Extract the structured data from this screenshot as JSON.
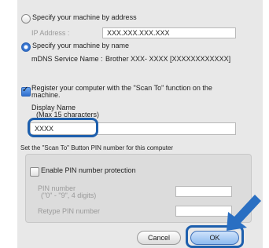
{
  "address_option": {
    "label": "Specify your machine by address",
    "selected": false
  },
  "ip": {
    "label": "IP Address :",
    "value": "XXX.XXX.XXX.XXX"
  },
  "name_option": {
    "label": "Specify your machine by name",
    "selected": true
  },
  "mdns": {
    "label": "mDNS Service Name :",
    "value": "Brother XXX- XXXX  [XXXXXXXXXXXX]"
  },
  "register": {
    "label_line1": "Register your computer with the \"Scan To\" function on the",
    "label_line2": "machine.",
    "checked": true
  },
  "display_name": {
    "label": "Display Name",
    "hint": "(Max 15 characters)",
    "value": "XXXX"
  },
  "pin_section": {
    "caption": "Set the \"Scan To\" Button PIN number for this computer",
    "enable_label": "Enable PIN number protection",
    "enable_checked": false,
    "pin_label": "PIN number",
    "pin_hint": "(\"0\" - \"9\", 4 digits)",
    "retype_label": "Retype PIN number"
  },
  "buttons": {
    "cancel": "Cancel",
    "ok": "OK"
  },
  "colors": {
    "highlight": "#1d5fad",
    "arrow": "#2a6fc2",
    "accent": "#3a7ad8"
  }
}
